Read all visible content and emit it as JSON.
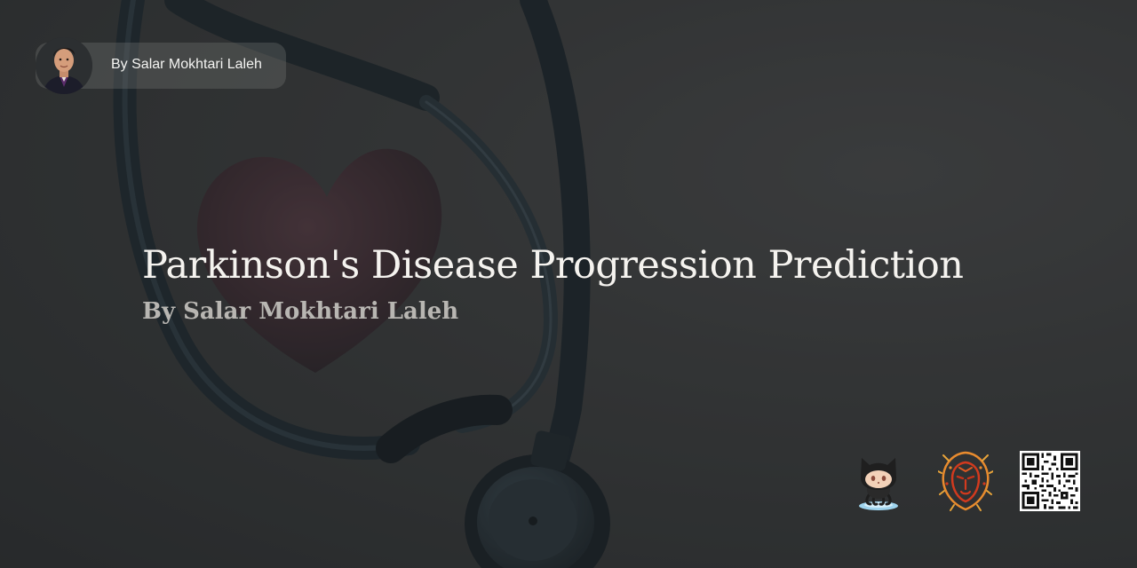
{
  "header": {
    "author_chip_label": "By Salar Mokhtari Laleh"
  },
  "main": {
    "title": "Parkinson's Disease Progression Prediction",
    "subtitle": "By Salar Mokhtari Laleh"
  },
  "footer_icons": {
    "github": "github-octocat-icon",
    "brand": "lion-logo-icon",
    "qr": "qr-code-icon"
  },
  "colors": {
    "background": "#3a3c3d",
    "title": "#f5f3ef",
    "subtitle": "#b8b6b2",
    "chip_bg": "#6b6f6a",
    "lion_red": "#d23a1e",
    "lion_orange": "#e88b2e"
  }
}
